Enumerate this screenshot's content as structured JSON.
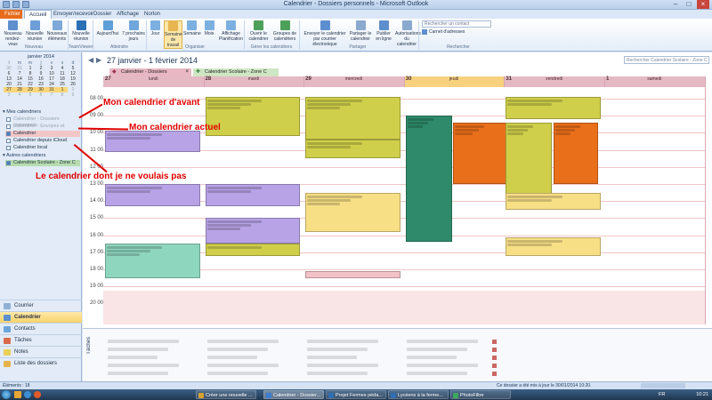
{
  "window": {
    "title": "Calendrier - Dossiers personnels  -  Microsoft Outlook"
  },
  "tabs": [
    "Fichier",
    "Accueil",
    "Envoyer/recevoir",
    "Dossier",
    "Affichage",
    "Norton"
  ],
  "ribbon": {
    "buttons": [
      {
        "label": "Nouveau rendez-vous",
        "icon": "calendar-new-icon",
        "color": "#5d8fcf"
      },
      {
        "label": "Nouvelle réunion",
        "icon": "meeting-icon",
        "color": "#6d9ed8"
      },
      {
        "label": "Nouveaux éléments",
        "icon": "new-items-icon",
        "color": "#7eaad9"
      },
      {
        "label": "Nouvelle réunion",
        "icon": "teamviewer-icon",
        "color": "#2b6fb5"
      },
      {
        "label": "Aujourd'hui",
        "icon": "today-icon",
        "color": "#5f9fd8"
      },
      {
        "label": "7 prochains jours",
        "icon": "next7-icon",
        "color": "#6fa6dc"
      },
      {
        "label": "Jour",
        "icon": "day-icon",
        "color": "#7cb0e0"
      },
      {
        "label": "Semaine de travail",
        "icon": "workweek-icon",
        "color": "#e8b650"
      },
      {
        "label": "Semaine",
        "icon": "week-icon",
        "color": "#7cb0e0"
      },
      {
        "label": "Mois",
        "icon": "month-icon",
        "color": "#7cb0e0"
      },
      {
        "label": "Affichage Planification",
        "icon": "schedule-icon",
        "color": "#7cb0e0"
      },
      {
        "label": "Ouvrir le calendrier",
        "icon": "open-calendar-icon",
        "color": "#4da05a"
      },
      {
        "label": "Groupes de calendriers",
        "icon": "calendar-groups-icon",
        "color": "#4da05a"
      },
      {
        "label": "Envoyer le calendrier par courrier électronique",
        "icon": "email-calendar-icon",
        "color": "#5d8fcf"
      },
      {
        "label": "Partager le calendrier",
        "icon": "share-calendar-icon",
        "color": "#8aa9cf"
      },
      {
        "label": "Publier en ligne",
        "icon": "publish-icon",
        "color": "#5d8fcf"
      },
      {
        "label": "Autorisations du calendrier",
        "icon": "permissions-icon",
        "color": "#8aa9cf"
      }
    ],
    "groups": [
      "Nouveau",
      "TeamViewer",
      "Atteindre",
      "Organiser",
      "Gérer les calendriers",
      "Partager",
      "Rechercher"
    ],
    "search_contact": "Rechercher un contact",
    "address_book": "Carnet d'adresses"
  },
  "mini_calendar": {
    "title": "janvier 2014",
    "days": [
      "30",
      "31",
      "1",
      "2",
      "3",
      "4",
      "5",
      "6",
      "7",
      "8",
      "9",
      "10",
      "11",
      "12",
      "13",
      "14",
      "15",
      "16",
      "17",
      "18",
      "19",
      "20",
      "21",
      "22",
      "23",
      "24",
      "25",
      "26",
      "27",
      "28",
      "29",
      "30",
      "31",
      "1",
      "2",
      "3",
      "4",
      "5",
      "6",
      "7",
      "8",
      "9"
    ]
  },
  "nav": {
    "my_calendars": "Mes calendriers",
    "items": [
      "Calendrier - Dossiers personnels",
      "Calendrier - Envoyez et archivage",
      "Calendrier",
      "Calendrier depuis iCloud",
      "Calendrier local"
    ],
    "other_calendars": "Autres calendriers",
    "other_items": [
      "Calendrier Scolaire - Zone C"
    ],
    "bottom": [
      "Courrier",
      "Calendrier",
      "Contacts",
      "Tâches",
      "Notes",
      "Liste des dossiers"
    ]
  },
  "main": {
    "date_range": "27 janvier - 1 février 2014",
    "search_placeholder": "Rechercher Calendrier Scolaire - Zone C",
    "cal_tabs": [
      "Calendrier - Dossiers personnels",
      "Calendrier Scolaire - Zone C"
    ],
    "days": [
      {
        "num": "27",
        "name": "lundi"
      },
      {
        "num": "28",
        "name": "mardi"
      },
      {
        "num": "29",
        "name": "mercredi"
      },
      {
        "num": "30",
        "name": "jeudi"
      },
      {
        "num": "31",
        "name": "vendredi"
      },
      {
        "num": "1",
        "name": "samedi"
      }
    ],
    "hours": [
      "08 00",
      "09 00",
      "10 00",
      "11 00",
      "12 00",
      "13 00",
      "14 00",
      "15 00",
      "16 00",
      "17 00",
      "18 00",
      "19 00",
      "20 00"
    ],
    "tasks_label": "Tâches"
  },
  "annotations": [
    "Mon calendrier d'avant",
    "Mon calendrier actuel",
    "Le calendrier dont je ne voulais pas"
  ],
  "status": {
    "left": "Éléments : 18",
    "right": "Ce dossier a été mis à jour le 30/01/2014 10:20."
  },
  "taskbar": {
    "items": [
      "Créer une nouvelle ...",
      "Calendrier - Dossier...",
      "Projet Fermes péda...",
      "Lycéens à la ferme...",
      "PhotoFiltre"
    ],
    "lang": "FR",
    "clock": "10:21"
  },
  "colors": {
    "accent": "#e66b1a",
    "annotation": "#e00000",
    "today": "#f6d27e"
  }
}
